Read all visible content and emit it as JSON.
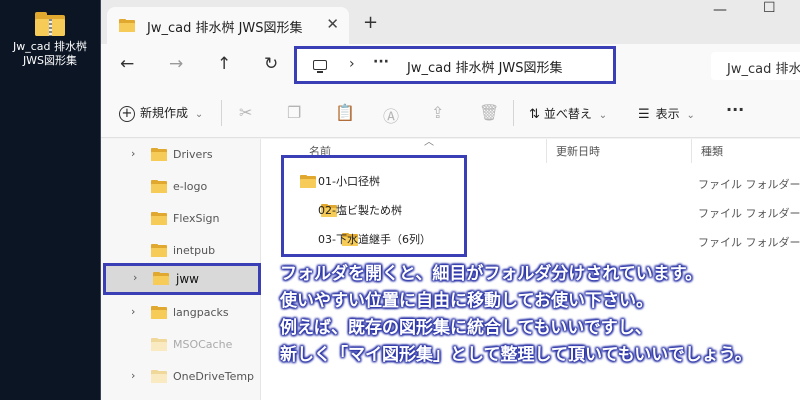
{
  "desktop": {
    "icon_label_line1": "Jw_cad 排水桝",
    "icon_label_line2": "JWS図形集"
  },
  "window": {
    "tab_title": "Jw_cad 排水桝 JWS図形集",
    "tab_close": "✕",
    "new_tab": "+",
    "minimize": "—",
    "maximize": "☐"
  },
  "address": {
    "separator": "›",
    "more": "···",
    "path": "Jw_cad 排水桝 JWS図形集",
    "search_text": "Jw_cad 排水桝"
  },
  "toolbar": {
    "new_label": "新規作成",
    "new_caret": "⌄",
    "sort_label": "並べ替え",
    "view_label": "表示",
    "more_label": "···"
  },
  "sidebar": {
    "items": [
      {
        "name": "Drivers"
      },
      {
        "name": "e-logo"
      },
      {
        "name": "FlexSign"
      },
      {
        "name": "inetpub"
      },
      {
        "name": "jww"
      },
      {
        "name": "langpacks"
      },
      {
        "name": "MSOCache"
      },
      {
        "name": "OneDriveTemp"
      }
    ]
  },
  "columns": {
    "name": "名前",
    "date": "更新日時",
    "type": "種類"
  },
  "files": [
    {
      "name": "01-小口径桝",
      "type": "ファイル フォルダー"
    },
    {
      "name": "02-塩ビ製ため桝",
      "type": "ファイル フォルダー"
    },
    {
      "name": "03-下水道継手（6列）",
      "type": "ファイル フォルダー"
    }
  ],
  "caption": {
    "line1": "フォルダを開くと、細目がフォルダ分けされています。",
    "line2": "使いやすい位置に自由に移動してお使い下さい。",
    "line3": "例えば、既存の図形集に統合してもいいですし、",
    "line4": "新しく「マイ図形集」として整理して頂いてもいいでしょう。"
  },
  "colors": {
    "highlight_border": "#3b3fb6",
    "folder": "#f6cb58"
  }
}
